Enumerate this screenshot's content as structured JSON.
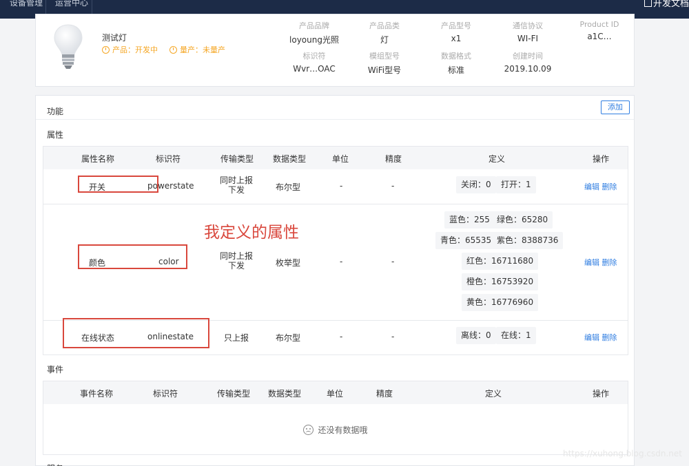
{
  "topbar": {
    "nav": [
      "设备管理",
      "运营中心"
    ],
    "doc_label": "开发文档"
  },
  "product": {
    "name": "测试灯",
    "status_dev": "产品：开发中",
    "status_mass": "量产：未量产",
    "meta": [
      {
        "key": "产品品牌",
        "value": "loyoung光照"
      },
      {
        "key": "产品品类",
        "value": "灯"
      },
      {
        "key": "产品型号",
        "value": "x1"
      },
      {
        "key": "通信协议",
        "value": "WI-FI"
      },
      {
        "key": "Product ID",
        "value": "a1C…"
      },
      {
        "key": "标识符",
        "value": "Wvr…OAC"
      },
      {
        "key": "模组型号",
        "value": "WiFi型号"
      },
      {
        "key": "数据格式",
        "value": "标准"
      },
      {
        "key": "创建时间",
        "value": "2019.10.09"
      }
    ]
  },
  "functions": {
    "title": "功能",
    "add_button": "添加",
    "properties_title": "属性",
    "events_title": "事件",
    "next_section_partial": "服务",
    "columns": [
      "属性名称",
      "标识符",
      "传输类型",
      "数据类型",
      "单位",
      "精度",
      "定义",
      "操作"
    ],
    "event_columns": [
      "事件名称",
      "标识符",
      "传输类型",
      "数据类型",
      "单位",
      "精度",
      "定义",
      "操作"
    ],
    "rows": [
      {
        "name": "开关",
        "identifier": "powerstate",
        "transport": "同时上报下发",
        "datatype": "布尔型",
        "unit": "-",
        "precision": "-",
        "defs": [
          "关闭：0",
          "打开：1"
        ]
      },
      {
        "name": "颜色",
        "identifier": "color",
        "transport": "同时上报下发",
        "datatype": "枚举型",
        "unit": "-",
        "precision": "-",
        "defs": [
          "蓝色：255",
          "绿色：65280",
          "青色：65535",
          "紫色：8388736",
          "红色：16711680",
          "橙色：16753920",
          "黄色：16776960"
        ]
      },
      {
        "name": "在线状态",
        "identifier": "onlinestate",
        "transport": "只上报",
        "datatype": "布尔型",
        "unit": "-",
        "precision": "-",
        "defs": [
          "离线：0",
          "在线：1"
        ]
      }
    ],
    "edit_label": "编辑",
    "delete_label": "删除",
    "empty_text": "还没有数据哦"
  },
  "annotation": "我定义的属性",
  "watermark": "https://xuhong.blog.csdn.net"
}
